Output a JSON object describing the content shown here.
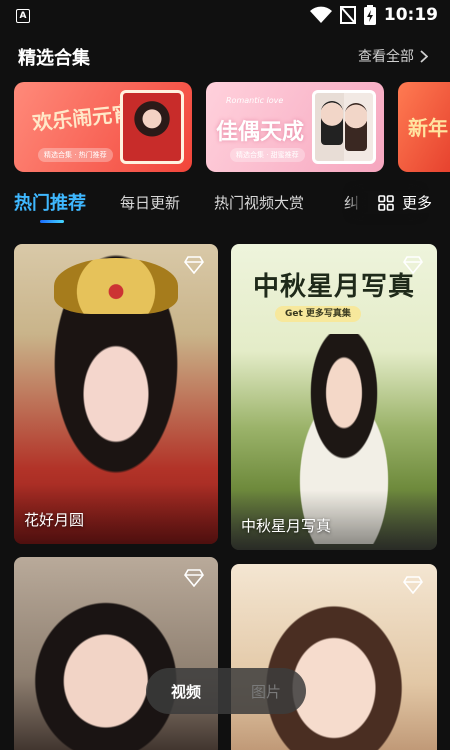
{
  "status_bar": {
    "app_badge": "A",
    "time": "10:19",
    "icons": [
      "wifi-icon",
      "no-signal-icon",
      "battery-charging-icon"
    ]
  },
  "collection": {
    "title": "精选合集",
    "see_all": "查看全部",
    "banners": [
      {
        "text": "欢乐闹元宵",
        "chip": "精选合集 · 热门推荐"
      },
      {
        "text": "佳偶天成",
        "sub": "Romantic love",
        "chip": "精选合集 · 甜蜜推荐"
      },
      {
        "text": "新年"
      }
    ]
  },
  "tabs": {
    "items": [
      "热门推荐",
      "每日更新",
      "热门视频大赏",
      "纠"
    ],
    "active_index": 0,
    "more": "更多"
  },
  "cards": [
    {
      "label": "花好月圆"
    },
    {
      "label": "中秋星月写真",
      "overlay_title": "中秋星月写真",
      "overlay_pill": "Get 更多写真集"
    },
    {
      "label": ""
    },
    {
      "label": ""
    }
  ],
  "toggle": {
    "video": "视频",
    "image": "图片",
    "active": "视频"
  },
  "colors": {
    "accent": "#3fb8ff",
    "background": "#101010"
  }
}
